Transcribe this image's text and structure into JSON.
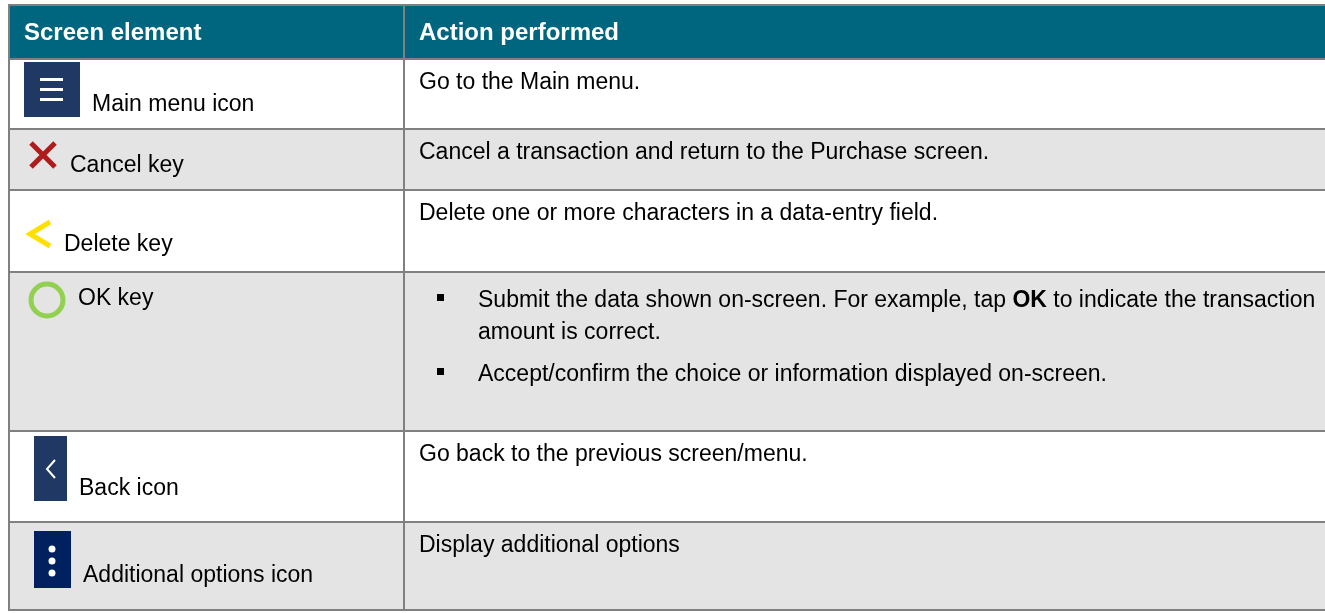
{
  "table": {
    "columns": [
      "Screen element",
      "Action performed"
    ],
    "rows": [
      {
        "kind": "menu",
        "element": "Main menu icon",
        "action": "Go to the Main menu."
      },
      {
        "kind": "cancel",
        "element": "Cancel key",
        "action": "Cancel a transaction and return to the Purchase screen."
      },
      {
        "kind": "delete",
        "element": "Delete key",
        "action": "Delete one or more characters in a data-entry field."
      },
      {
        "kind": "ok",
        "element": "OK key",
        "bullets": [
          "Submit the data shown on-screen. For example, tap **OK** to indicate the transaction amount is correct.",
          "Accept/confirm the choice or information displayed on-screen."
        ]
      },
      {
        "kind": "back",
        "element": "Back icon",
        "action": "Go back to the previous screen/menu."
      },
      {
        "kind": "more",
        "element": "Additional options icon",
        "action": "Display additional options"
      }
    ]
  }
}
